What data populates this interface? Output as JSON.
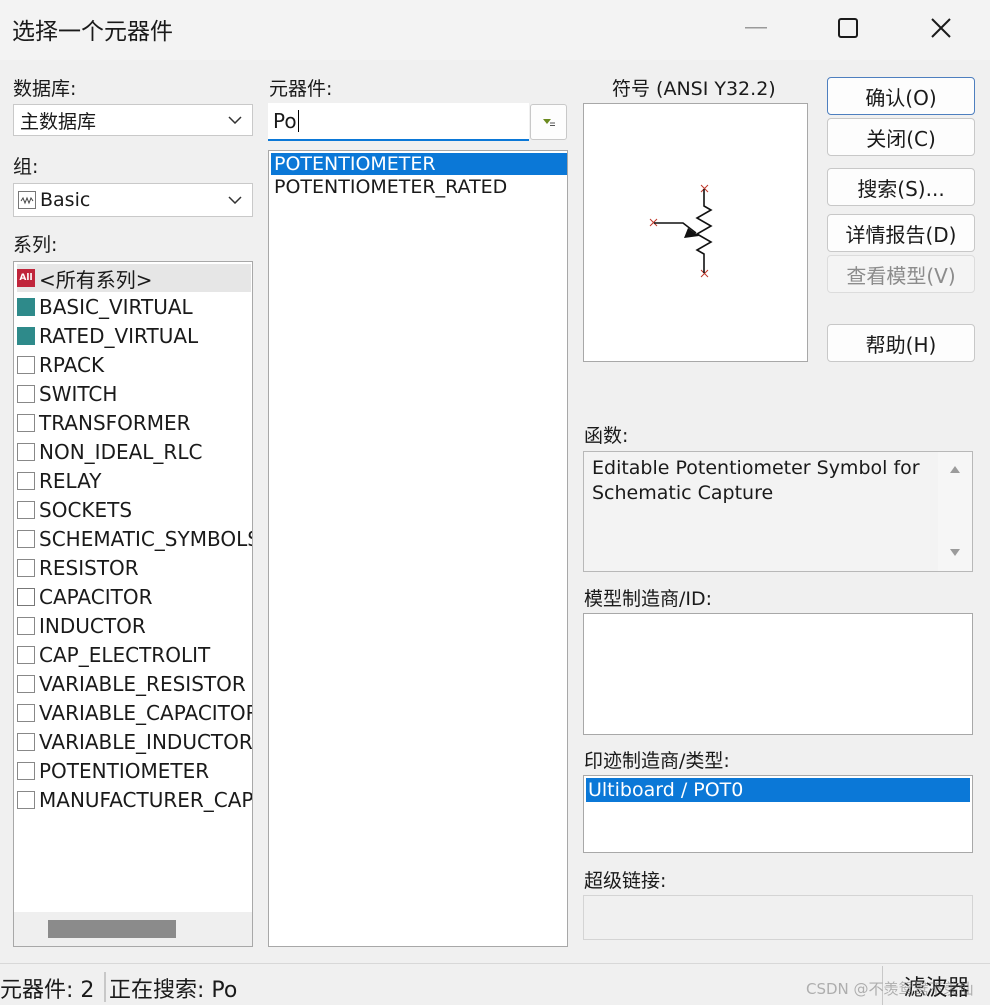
{
  "window": {
    "title": "选择一个元器件"
  },
  "database": {
    "label": "数据库:",
    "value": "主数据库"
  },
  "group": {
    "label": "组:",
    "value": "Basic"
  },
  "series": {
    "label": "系列:",
    "items": [
      {
        "icon": "all-icon",
        "text": "<所有系列>"
      },
      {
        "icon": "basic-virtual-icon",
        "text": "BASIC_VIRTUAL"
      },
      {
        "icon": "rated-virtual-icon",
        "text": "RATED_VIRTUAL"
      },
      {
        "icon": "rpack-icon",
        "text": "RPACK"
      },
      {
        "icon": "switch-icon",
        "text": "SWITCH"
      },
      {
        "icon": "transformer-icon",
        "text": "TRANSFORMER"
      },
      {
        "icon": "non-ideal-rlc-icon",
        "text": "NON_IDEAL_RLC"
      },
      {
        "icon": "relay-icon",
        "text": "RELAY"
      },
      {
        "icon": "sockets-icon",
        "text": "SOCKETS"
      },
      {
        "icon": "schematic-symbols-icon",
        "text": "SCHEMATIC_SYMBOLS"
      },
      {
        "icon": "resistor-icon",
        "text": "RESISTOR"
      },
      {
        "icon": "capacitor-icon",
        "text": "CAPACITOR"
      },
      {
        "icon": "inductor-icon",
        "text": "INDUCTOR"
      },
      {
        "icon": "cap-electrolit-icon",
        "text": "CAP_ELECTROLIT"
      },
      {
        "icon": "variable-resistor-icon",
        "text": "VARIABLE_RESISTOR"
      },
      {
        "icon": "variable-capacitor-icon",
        "text": "VARIABLE_CAPACITOR"
      },
      {
        "icon": "variable-inductor-icon",
        "text": "VARIABLE_INDUCTOR"
      },
      {
        "icon": "potentiometer-icon",
        "text": "POTENTIOMETER"
      },
      {
        "icon": "manufacturer-cap-icon",
        "text": "MANUFACTURER_CAPACITOR"
      }
    ]
  },
  "component": {
    "label": "元器件:",
    "search_value": "Po",
    "results": [
      "POTENTIOMETER",
      "POTENTIOMETER_RATED"
    ]
  },
  "symbol": {
    "label": "符号 (ANSI Y32.2)"
  },
  "buttons": {
    "ok": "确认(O)",
    "close": "关闭(C)",
    "search": "搜索(S)...",
    "detail_report": "详情报告(D)",
    "view_model": "查看模型(V)",
    "help": "帮助(H)"
  },
  "function": {
    "label": "函数:",
    "text": "Editable Potentiometer Symbol for Schematic Capture"
  },
  "model_manufacturer": {
    "label": "模型制造商/ID:"
  },
  "footprint": {
    "label": "印迹制造商/类型:",
    "selected": "Ultiboard / POT0"
  },
  "hyperlink": {
    "label": "超级链接:"
  },
  "statusbar": {
    "components": "元器件: 2",
    "searching": "正在搜索: Po",
    "filter_button": "滤波器",
    "watermark": "CSDN @不羡鸳鸯不羡仙"
  }
}
